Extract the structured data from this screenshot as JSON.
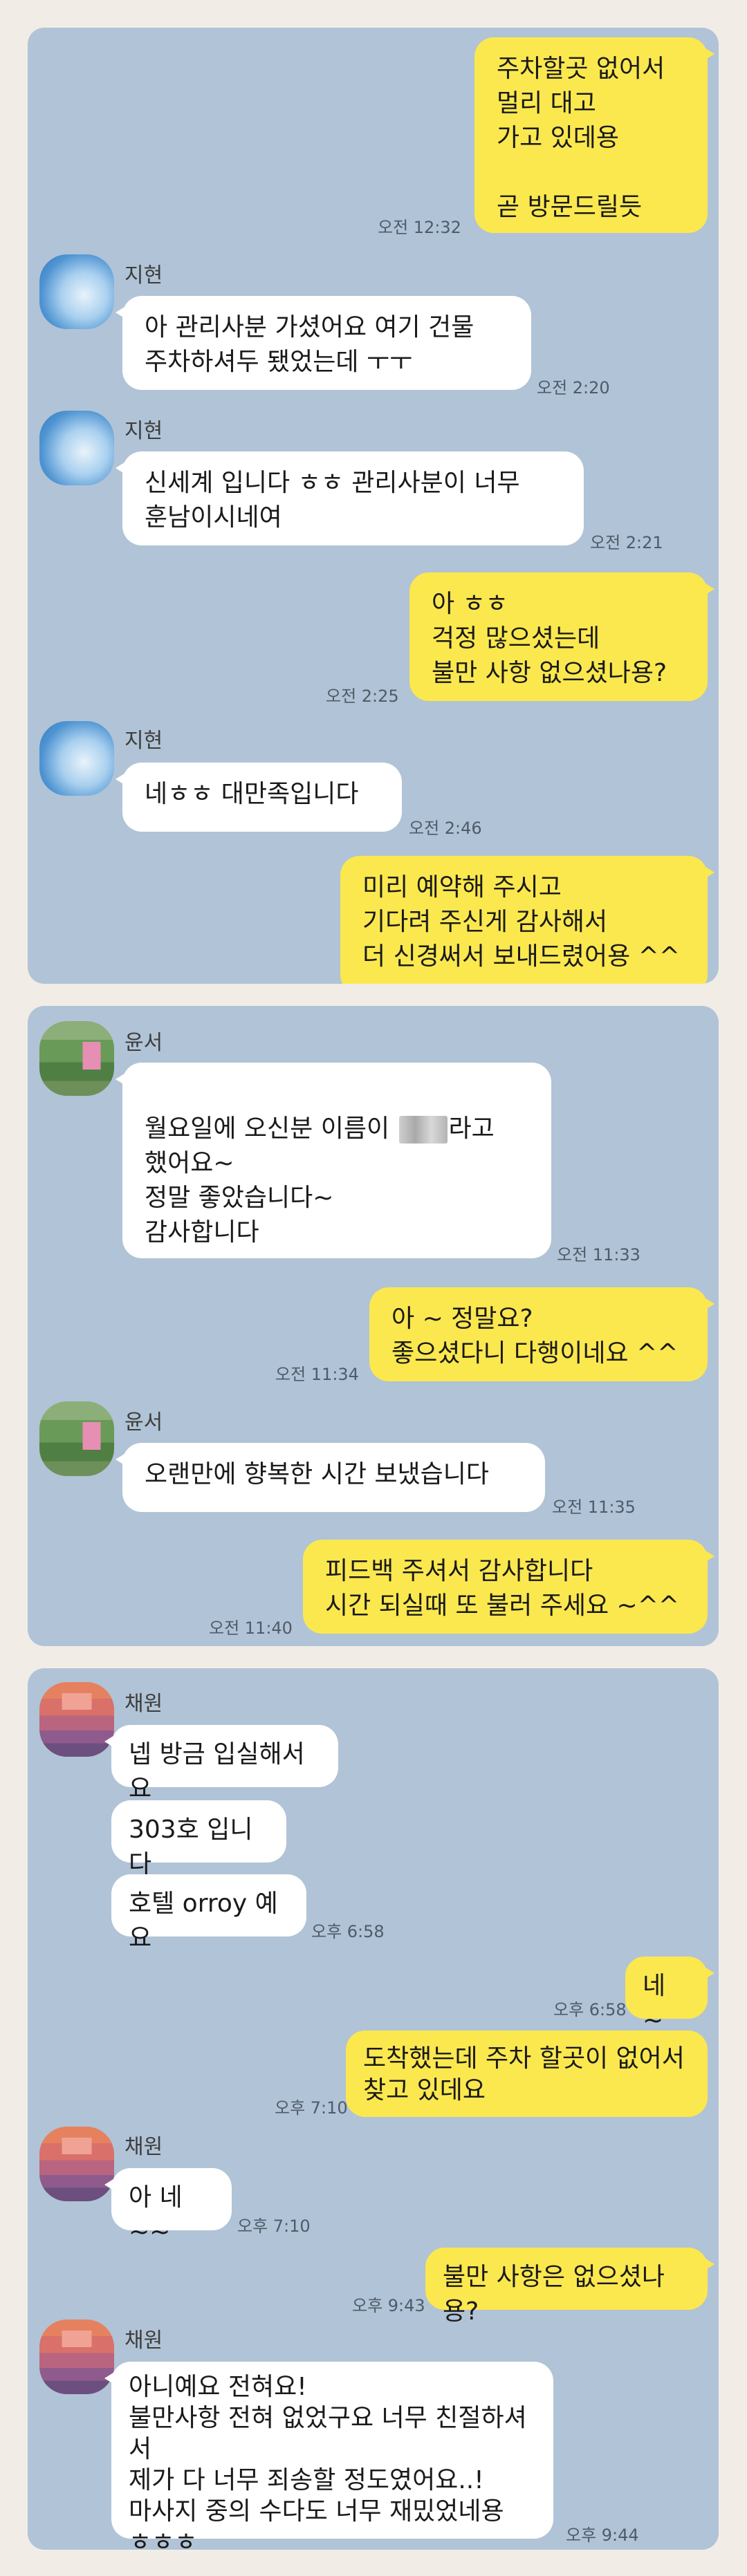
{
  "panel1": {
    "msg1": {
      "text": "주차할곳 없어서\n멀리 대고\n가고 있데용\n\n곧 방문드릴듯",
      "time": "오전 12:32"
    },
    "sender": "지현",
    "msg2": {
      "text": "아 관리사분 가셨어요 여기 건물\n주차하셔두 됐었는데 ㅜㅜ",
      "time": "오전 2:20"
    },
    "msg3": {
      "text": "신세계 입니다 ㅎㅎ 관리사분이 너무\n훈남이시네여",
      "time": "오전 2:21"
    },
    "msg4": {
      "text": "아 ㅎㅎ\n걱정 많으셨는데\n불만 사항 없으셨나용?",
      "time": "오전 2:25"
    },
    "msg5": {
      "text": "네ㅎㅎ 대만족입니다",
      "time": "오전 2:46"
    },
    "msg6": {
      "text": "미리 예약해 주시고\n기다려 주신게 감사해서\n더 신경써서 보내드렸어용 ^^"
    }
  },
  "panel2": {
    "sender": "윤서",
    "msg1": {
      "line1_a": "월요일에 오신분 이름이 ",
      "line1_b": "라고",
      "rest": "했어요~\n정말 좋았습니다~\n감사합니다",
      "time": "오전 11:33"
    },
    "msg2": {
      "text": "아 ~ 정말요?\n좋으셨다니 다행이네요 ^^",
      "time": "오전 11:34"
    },
    "msg3": {
      "text": "오랜만에 향복한 시간 보냈습니다",
      "time": "오전 11:35"
    },
    "msg4": {
      "text": "피드백 주셔서 감사합니다\n시간 되실때 또 불러 주세요 ~^^",
      "time": "오전 11:40"
    }
  },
  "panel3": {
    "sender": "채원",
    "msg1": {
      "text": "넵 방금 입실해서요"
    },
    "msg2": {
      "text": "303호 입니다"
    },
    "msg3": {
      "text": "호텔 orroy 예요",
      "time": "오후 6:58"
    },
    "msg4": {
      "text": "네 ~",
      "time": "오후 6:58"
    },
    "msg5": {
      "text": "도착했는데  주차 할곳이 없어서\n찾고 있데요",
      "time": "오후 7:10"
    },
    "msg6": {
      "text": "아 네~~",
      "time": "오후 7:10"
    },
    "msg7": {
      "text": "불만 사항은 없으셨나용?",
      "time": "오후 9:43"
    },
    "msg8": {
      "text": "아니예요 전혀요!\n불만사항 전혀 없었구요 너무 친절하셔서\n제가 다 너무 죄송할 정도였어요..!\n마사지 중의 수다도 너무 재밌었네용\nㅎㅎㅎ",
      "time": "오후 9:44"
    }
  },
  "colors": {
    "background": "#f1ede6",
    "panel": "#b1c3d6",
    "outgoing": "#fbe84f",
    "incoming": "#ffffff"
  }
}
